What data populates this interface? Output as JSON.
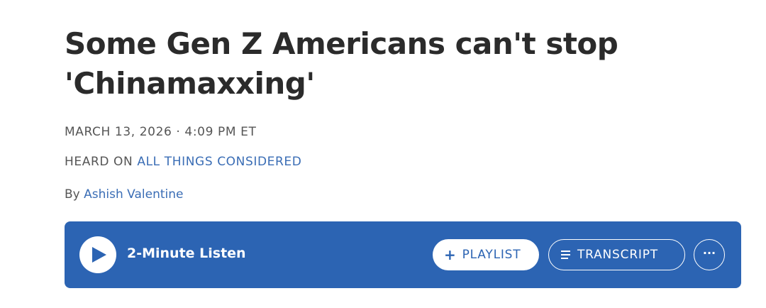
{
  "article": {
    "headline": "Some Gen Z Americans can't stop 'Chinamaxxing'",
    "date": "MARCH 13, 2026 · 4:09 PM ET",
    "heard_on_prefix": "HEARD ON ",
    "program": "ALL THINGS CONSIDERED",
    "byline_prefix": "By ",
    "author": "Ashish Valentine"
  },
  "player": {
    "listen_label": "2-Minute Listen",
    "playlist_plus": "+",
    "playlist_label": "PLAYLIST",
    "transcript_label": "TRANSCRIPT",
    "more_label": "···",
    "bar_color": "#2c64b3",
    "play_icon": "play-icon",
    "transcript_icon": "lines-icon"
  }
}
